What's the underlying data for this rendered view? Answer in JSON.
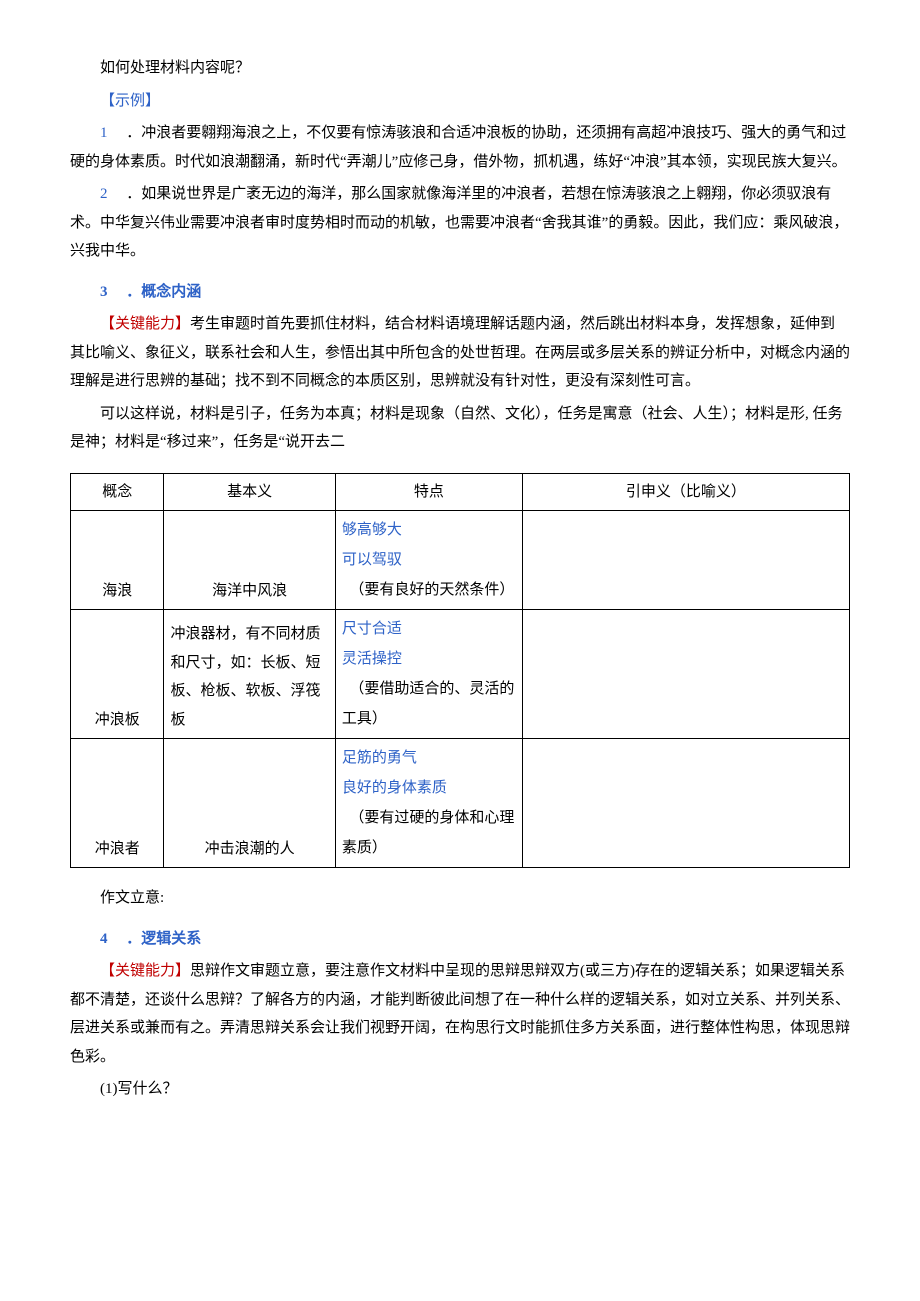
{
  "q0": "如何处理材料内容呢？",
  "example_label": "【示例】",
  "ex1_num": "1",
  "ex1": " ．冲浪者要翱翔海浪之上，不仅要有惊涛骇浪和合适冲浪板的协助，还须拥有高超冲浪技巧、强大的勇气和过硬的身体素质。时代如浪潮翻涌，新时代“弄潮儿”应修己身，借外物，抓机遇，练好“冲浪”其本领，实现民族大复兴。",
  "ex2_num": "2",
  "ex2": " ．如果说世界是广袤无边的海洋，那么国家就像海洋里的冲浪者，若想在惊涛骇浪之上翱翔，你必须驭浪有术。中华复兴伟业需要冲浪者审时度势相时而动的机敏，也需要冲浪者“舍我其谁”的勇毅。因此，我们应：乘风破浪，兴我中华。",
  "sec3_num": "3",
  "sec3_title": "．概念内涵",
  "key_label": "【关键能力】",
  "sec3_body1": "考生审题时首先要抓住材料，结合材料语境理解话题内涵，然后跳出材料本身，发挥想象，延伸到其比喻义、象征义，联系社会和人生，参悟出其中所包含的处世哲理。在两层或多层关系的辨证分析中，对概念内涵的理解是进行思辨的基础；找不到不同概念的本质区别，思辨就没有针对性，更没有深刻性可言。",
  "sec3_body2": "可以这样说，材料是引子，任务为本真；材料是现象（自然、文化），任务是寓意（社会、人生）；材料是形, 任务是神；材料是“移过来”，任务是“说开去二",
  "table": {
    "h1": "概念",
    "h2": "基本义",
    "h3": "特点",
    "h4": "引申义（比喻义）",
    "r1c1": "海浪",
    "r1c2": "海洋中风浪",
    "r1c3a": "够高够大",
    "r1c3b": "可以驾驭",
    "r1c3c": "　（要有良好的天然条件）",
    "r2c1": "冲浪板",
    "r2c2": "冲浪器材，有不同材质和尺寸，如：长板、短板、枪板、软板、浮筏板",
    "r2c3a": "尺寸合适",
    "r2c3b": "灵活操控",
    "r2c3c": "　（要借助适合的、灵活的工具）",
    "r3c1": "冲浪者",
    "r3c2": "冲击浪潮的人",
    "r3c3a": "足筋的勇气",
    "r3c3b": "良好的身体素质",
    "r3c3c": "　（要有过硬的身体和心理素质）"
  },
  "liyi": "作文立意:",
  "sec4_num": "4",
  "sec4_title": "．逻辑关系",
  "sec4_body": "思辩作文审题立意，要注意作文材料中呈现的思辩思辩双方(或三方)存在的逻辑关系；如果逻辑关系都不清楚，还谈什么思辩？了解各方的内涵，才能判断彼此间想了在一种什么样的逻辑关系，如对立关系、并列关系、层进关系或兼而有之。弄清思辩关系会让我们视野开阔，在构思行文时能抓住多方关系面，进行整体性构思，体现思辩色彩。",
  "q1": "(1)写什么？"
}
